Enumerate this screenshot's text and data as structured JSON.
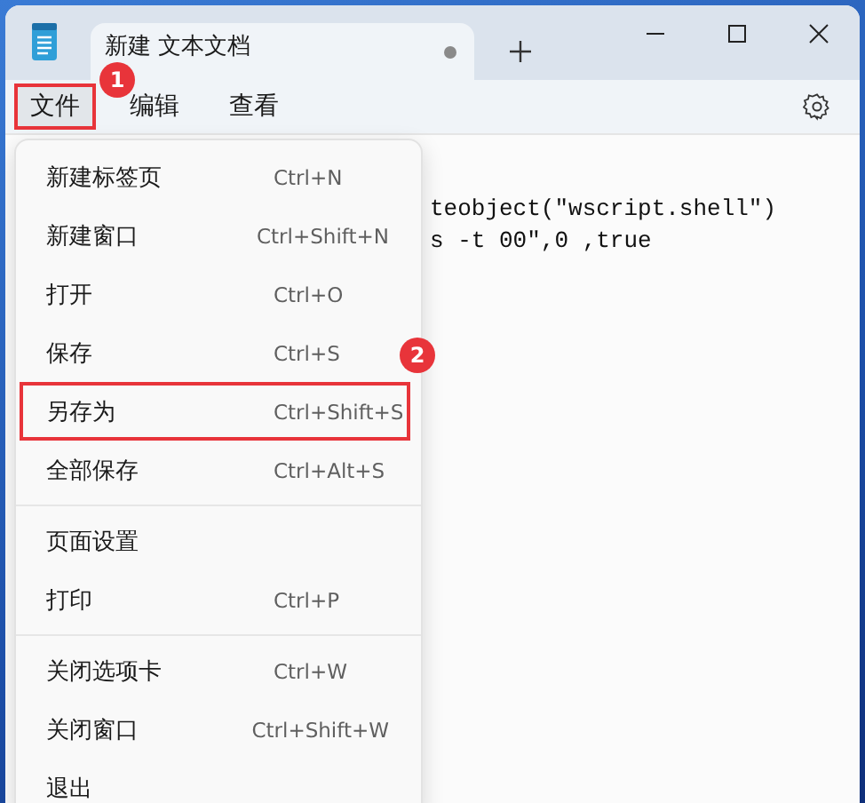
{
  "tab": {
    "title": "新建 文本文档",
    "unsaved": true
  },
  "menubar": [
    {
      "label": "文件",
      "selected": true,
      "highlighted": true
    },
    {
      "label": "编辑",
      "selected": false,
      "highlighted": false
    },
    {
      "label": "查看",
      "selected": false,
      "highlighted": false
    }
  ],
  "editor": {
    "lines": [
      "teobject(\"wscript.shell\")",
      "s -t 00\",0 ,true"
    ]
  },
  "file_menu": {
    "groups": [
      [
        {
          "label": "新建标签页",
          "shortcut": "Ctrl+N",
          "highlighted": false
        },
        {
          "label": "新建窗口",
          "shortcut": "Ctrl+Shift+N",
          "highlighted": false
        },
        {
          "label": "打开",
          "shortcut": "Ctrl+O",
          "highlighted": false
        },
        {
          "label": "保存",
          "shortcut": "Ctrl+S",
          "highlighted": false
        },
        {
          "label": "另存为",
          "shortcut": "Ctrl+Shift+S",
          "highlighted": true
        },
        {
          "label": "全部保存",
          "shortcut": "Ctrl+Alt+S",
          "highlighted": false
        }
      ],
      [
        {
          "label": "页面设置",
          "highlighted": false
        },
        {
          "label": "打印",
          "shortcut": "Ctrl+P",
          "highlighted": false
        }
      ],
      [
        {
          "label": "关闭选项卡",
          "shortcut": "Ctrl+W",
          "highlighted": false
        },
        {
          "label": "关闭窗口",
          "shortcut": "Ctrl+Shift+W",
          "highlighted": false
        },
        {
          "label": "退出",
          "highlighted": false
        }
      ]
    ]
  },
  "annotations": [
    {
      "number": "1"
    },
    {
      "number": "2"
    }
  ]
}
